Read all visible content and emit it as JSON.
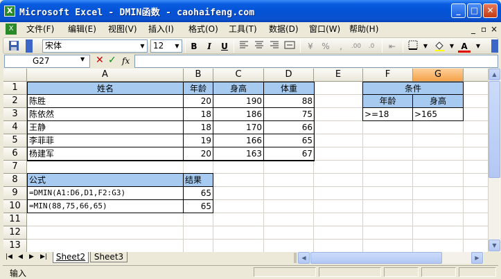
{
  "window": {
    "title": "Microsoft Excel - DMIN函数 - caohaifeng.com",
    "app_icon": "X",
    "minimize": "_",
    "maximize": "□",
    "close": "✕"
  },
  "menu": {
    "items": [
      "文件(F)",
      "编辑(E)",
      "视图(V)",
      "插入(I)",
      "格式(O)",
      "工具(T)",
      "数据(D)",
      "窗口(W)",
      "帮助(H)"
    ],
    "doc_controls": [
      "_",
      "▫",
      "×"
    ]
  },
  "toolbar": {
    "font": "宋体",
    "size": "12",
    "bold": "B",
    "italic": "I",
    "underline": "U",
    "percent": "%",
    "comma": ",",
    "font_color_label": "A",
    "font_color": "#E00000"
  },
  "formula_bar": {
    "name_box": "G27",
    "fx": "fx",
    "cancel": "✕",
    "enter": "✓",
    "formula": ""
  },
  "grid": {
    "columns": [
      "A",
      "B",
      "C",
      "D",
      "E",
      "F",
      "G"
    ],
    "selected_column": "G",
    "rows": [
      "1",
      "2",
      "3",
      "4",
      "5",
      "6",
      "7",
      "8",
      "9",
      "10",
      "11",
      "12",
      "13"
    ],
    "data": {
      "header": [
        "姓名",
        "年龄",
        "身高",
        "体重"
      ],
      "records": [
        [
          "陈胜",
          "20",
          "190",
          "88"
        ],
        [
          "陈依然",
          "18",
          "186",
          "75"
        ],
        [
          "王静",
          "18",
          "170",
          "66"
        ],
        [
          "李菲菲",
          "19",
          "166",
          "65"
        ],
        [
          "杨建军",
          "20",
          "163",
          "67"
        ]
      ]
    },
    "criteria": {
      "title": "条件",
      "headers": [
        "年龄",
        "身高"
      ],
      "values": [
        ">=18",
        ">165"
      ]
    },
    "formulas": {
      "header": [
        "公式",
        "结果"
      ],
      "rows": [
        [
          "=DMIN(A1:D6,D1,F2:G3)",
          "65"
        ],
        [
          "=MIN(88,75,66,65)",
          "65"
        ]
      ]
    },
    "header_color": "#A6CAF0"
  },
  "sheets": {
    "tabs": [
      "Sheet2",
      "Sheet3"
    ],
    "active": "Sheet2"
  },
  "status": {
    "mode": "输入"
  }
}
